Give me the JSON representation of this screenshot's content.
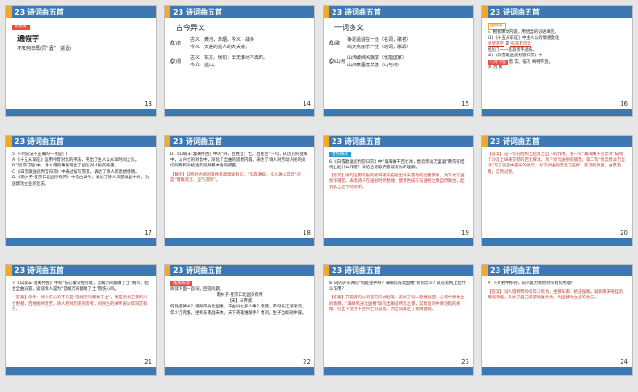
{
  "colors": {
    "header": "#3d78b2",
    "accent": "#f2a82a",
    "highlight": "#e84c3d",
    "answer": "#c0392b",
    "background": "#e6e6e6"
  },
  "slides": [
    {
      "num": "13",
      "title": "23 诗词曲五首",
      "tag": "积累篇",
      "heading": "通假字",
      "lines": [
        "不知何日再(同“酒”，进酒)"
      ]
    },
    {
      "num": "14",
      "title": "23 诗词曲五首",
      "heading": "古今异义",
      "groups": [
        {
          "k": "(1)烽",
          "a": "古义：黄河，烽烟。今义：战争",
          "b": "今义：天差的遥人的大关楼。"
        },
        {
          "k": "(2)拐",
          "a": "古义：东方。例句：早无谁尽不再时。",
          "b": "今义：遥山。"
        }
      ]
    },
    {
      "num": "15",
      "title": "23 诗词曲五首",
      "heading": "一词多义",
      "groups": [
        {
          "k": "(1)歌",
          "a": "争逐遥遥在一处（名词，歌名）",
          "b": "鸣天点丽乐一处（动词，歌颂）"
        },
        {
          "k": "(2)山河",
          "a": "山河破碎风飘絮（代指国家）",
          "b": "山河表里潼关路（山与河）"
        }
      ]
    },
    {
      "num": "16",
      "title": "23 诗词曲五首",
      "tag": "理解篇",
      "lines": [
        "4. 根据课文内容，用恰当的词语填空。",
        "(1)《十五从军征》中主人公的情感变化",
        "是",
        "经历了一一悲哀而不悲伤。",
        "(2)《白雪歌送武判官归京》中",
        "借",
        "实，描写",
        "奇特不变。",
        "热",
        "为",
        "我"
      ],
      "fill1": "希望落空",
      "fill2": "伤悲无可诉",
      "fill3": "八月飞雪"
    },
    {
      "num": "17",
      "title": "23 诗词曲五首",
      "lines": [
        "5. 下列说法不正确的一项是(   )",
        "A.《十五从军征》运用今昔对比的手法，突出了主人公从军时间之久。",
        "B.“近京门陌”中，诗人借叙事展现出了战乱对人民的伤害。",
        "C.《白雪歌送武判官归京》中通过描写雪景，表达了诗人的思想感情。",
        "D.《南乡子·登京口北固亭有怀》中借古讽今，表达了诗人渴望收复中原，为国建功立业的壮志。"
      ]
    },
    {
      "num": "18",
      "title": "23 诗词曲五首",
      "lines": [
        "D.《山坡羊·潼关怀古》中的“兴，百姓苦；亡，百姓苦”一句，从历史的变革中，从兴亡的对比中，深化了全曲的思想内容，表达了诗人对劳动人民的关切同情和对统治阶段残暴本质的揭露。",
        "【解析】D项对古诗的情感基调理解有误。“悲哀难抑，令人难以自禁”应是“慷慨悲壮、正气凛然”。"
      ],
      "answer": "【解析】D项对古诗的情感基调理解有误，“悲哀难抑，令人难以自禁”应是“慷慨悲壮、正气凛然”。"
    },
    {
      "num": "19",
      "title": "23 诗词曲五首",
      "tag": "合作探究",
      "lines": [
        "6.《白雪歌送武判官归京》中“瀚海阑干百丈冰，愁云惨淡万里凝”两句在结构上起什么作用？请结合诗歌内容谈谈你的理解。"
      ],
      "answer": "【答案】诗句运用夸张的修辞手法描绘出冰天雪地的边塞景象，为下文写送别作铺垫，表现诗人在送别时的愁绪，使景色描写与送别之情自然融合，起到承上启下的作用。"
    },
    {
      "num": "20",
      "title": "23 诗词曲五首",
      "answer": "【答案】这一句在结构上起承上启下的作用。第一句“瀚海阑干百丈冰”描绘了沙漠上纵横交错的百丈厚冰，为下文写送别作铺垫；第二句“愁云惨淡万里凝”写了天空中密布的阴云，为下文送别营造了压抑、悲凉的氛围，由景及情，自然过渡。"
    },
    {
      "num": "21",
      "title": "23 诗词曲五首",
      "lines": [
        "7.《山坡羊·潼关怀古》中有“伤心秦汉经行处，宫阙万间都做了土”两句，结合全曲内容，谈谈诗人是为“宫阙万间都做了土”而伤心吗。"
      ],
      "answer": "【答案】示例：诗人伤心的不只是“宫阙万间都做了土”，更是历代王朝的兴亡更替，百姓始终受苦。诗人把对历史的思考，对民生的关怀表达得深沉有力。"
    },
    {
      "num": "22",
      "title": "23 诗词曲五首",
      "tag": "拓展阅读",
      "lines": [
        "阅读下面一首词，回答问题。",
        "南乡子·登京口北固亭有怀",
        "【宋】辛弃疾",
        "何处望神州？满眼风光北固楼。千古兴亡多少事？悠悠。不尽长江滚滚流。",
        "年少万兜鍪，坐断东南战未休。天下英雄谁敌手？曹刘。生子当如孙仲谋。"
      ]
    },
    {
      "num": "23",
      "title": "23 诗词曲五首",
      "lines": [
        "8. 词的开头两句“何处望神州？满眼风光北固楼”有何含义？其在结构上起什么作用？"
      ],
      "answer": "【答案】开篇两句以问答的形式起笔，表达了词人登楼远望、心系中原故土的情感。“满眼风光北固楼”既写出眼前所见之景，又暗含对中原沦陷的感慨，引出下文对千古兴亡的追思，为全词奠定了感情基调。"
    },
    {
      "num": "24",
      "title": "23 诗词曲五首",
      "lines": [
        "9. 下片君中称孙，词人极力称赞孙权有何用意？"
      ],
      "answer": "【答案】词人借称赞孙权年少有为、坐镇东南、抗击强敌，讽刺南宋朝廷的懦弱无能，表达了自己渴望收复失地、为国建功立业的壮志。"
    }
  ]
}
